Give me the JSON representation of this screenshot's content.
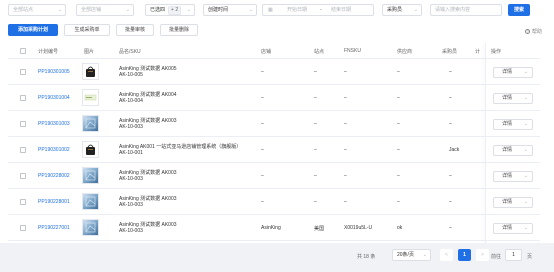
{
  "filters": {
    "site_placeholder": "全部站点",
    "shop_placeholder": "全部店铺",
    "selected_label": "已选",
    "selected_value": "已选四",
    "selected_more": "+ 2",
    "time_type": "创建时间",
    "start_placeholder": "开始日期",
    "range_sep": "-",
    "end_placeholder": "结束日期",
    "buyer_select": "采购员",
    "keyword_placeholder": "请输入搜索内容",
    "search_label": "搜索"
  },
  "toolbar": {
    "add_plan": "添加采购计划",
    "gen_order": "生成采购单",
    "batch_review": "批量审核",
    "batch_delete": "批量删除",
    "help": "帮助"
  },
  "table": {
    "headers": {
      "plan_no": "计划编号",
      "image": "图片",
      "name_sku": "品名/SKU",
      "shop": "店铺",
      "site": "站点",
      "fnsku": "FNSKU",
      "supplier": "供应商",
      "buyer": "采购员",
      "plan_qty": "计",
      "action": "操作"
    },
    "rows": [
      {
        "plan_no": "PP190301005",
        "thumb": "bag",
        "name": "AsinKing 测试数据 AK005",
        "sku": "AK-10-005",
        "shop": "–",
        "site": "–",
        "fnsku": "–",
        "supplier": "–",
        "buyer": "–",
        "qty": "",
        "action": "详情"
      },
      {
        "plan_no": "PP190301004",
        "thumb": "card",
        "name": "AsinKing 测试数据 AK004",
        "sku": "AK-10-004",
        "shop": "–",
        "site": "–",
        "fnsku": "–",
        "supplier": "–",
        "buyer": "–",
        "qty": "",
        "action": "详情"
      },
      {
        "plan_no": "PP190301003",
        "thumb": "blue",
        "name": "AsinKing 测试数据 AK003",
        "sku": "AK-10-003",
        "shop": "–",
        "site": "–",
        "fnsku": "–",
        "supplier": "–",
        "buyer": "–",
        "qty": "",
        "action": "详情"
      },
      {
        "plan_no": "PP190301002",
        "thumb": "bag",
        "name": "AsinKing AK001 一站式亚马逊店铺管理系统（旗舰版）",
        "sku": "AK-10-001",
        "shop": "–",
        "site": "–",
        "fnsku": "–",
        "supplier": "–",
        "buyer": "Jack",
        "qty": "",
        "action": "详情"
      },
      {
        "plan_no": "PP190228002",
        "thumb": "blue",
        "name": "AsinKing 测试数据 AK003",
        "sku": "AK-10-003",
        "shop": "–",
        "site": "–",
        "fnsku": "–",
        "supplier": "–",
        "buyer": "–",
        "qty": "",
        "action": "详情"
      },
      {
        "plan_no": "PP190228001",
        "thumb": "blue",
        "name": "AsinKing 测试数据 AK003",
        "sku": "AK-10-003",
        "shop": "–",
        "site": "–",
        "fnsku": "–",
        "supplier": "–",
        "buyer": "–",
        "qty": "",
        "action": "详情"
      },
      {
        "plan_no": "PP190227001",
        "thumb": "blue",
        "name": "AsinKing 测试数据 AK003",
        "sku": "AK-10-003",
        "shop": "AsinKing",
        "site": "美国",
        "fnsku": "X0019u5L-U",
        "supplier": "ok",
        "buyer": "–",
        "qty": "",
        "action": "详情"
      }
    ]
  },
  "pagination": {
    "total": "共 18 条",
    "page_size": "20条/页",
    "prev": "<",
    "current": "1",
    "next": ">",
    "goto_label": "前往",
    "goto_value": "1",
    "goto_unit": "页"
  },
  "colors": {
    "accent": "#1f6fe5",
    "link": "#1f6fe5"
  }
}
